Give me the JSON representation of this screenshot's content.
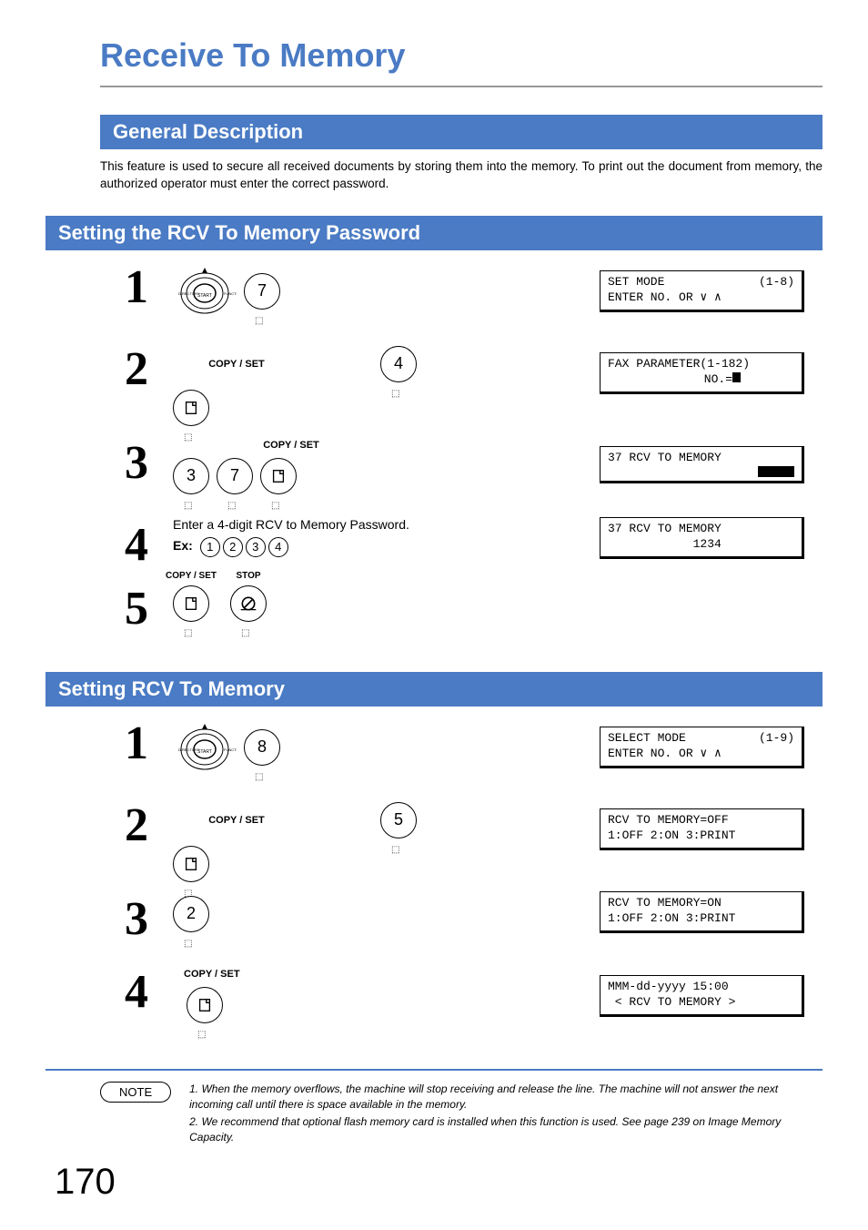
{
  "title": "Receive To Memory",
  "sections": {
    "general": {
      "heading": "General Description",
      "text": "This feature is used to secure all received documents by storing them into the memory.  To print out the document from memory, the authorized operator must enter the correct password."
    },
    "password": {
      "heading": "Setting the RCV To Memory Password",
      "steps": {
        "s1": {
          "num": "1",
          "key": "7",
          "lcd_l1a": "SET MODE",
          "lcd_l1b": "(1-8)",
          "lcd_l2": "ENTER NO. OR ∨ ∧"
        },
        "s2": {
          "num": "2",
          "label": "COPY / SET",
          "key": "4",
          "lcd_l1": "FAX PARAMETER(1-182)",
          "lcd_l2": "      NO.="
        },
        "s3": {
          "num": "3",
          "label": "COPY / SET",
          "key1": "3",
          "key2": "7",
          "lcd_l1": "37 RCV TO MEMORY"
        },
        "s4": {
          "num": "4",
          "text": "Enter a 4-digit RCV to Memory Password.",
          "ex_label": "Ex:",
          "ex_keys": [
            "1",
            "2",
            "3",
            "4"
          ],
          "lcd_l1": "37 RCV TO MEMORY",
          "lcd_l2": "            1234"
        },
        "s5": {
          "num": "5",
          "label1": "COPY / SET",
          "label2": "STOP"
        }
      }
    },
    "setting": {
      "heading": "Setting RCV To Memory",
      "steps": {
        "s1": {
          "num": "1",
          "key": "8",
          "lcd_l1a": "SELECT MODE",
          "lcd_l1b": "(1-9)",
          "lcd_l2": "ENTER NO. OR ∨ ∧"
        },
        "s2": {
          "num": "2",
          "label": "COPY / SET",
          "key": "5",
          "lcd_l1": "RCV TO MEMORY=OFF",
          "lcd_l2": "1:OFF 2:ON 3:PRINT"
        },
        "s3": {
          "num": "3",
          "key": "2",
          "lcd_l1": "RCV TO MEMORY=ON",
          "lcd_l2": "1:OFF 2:ON 3:PRINT"
        },
        "s4": {
          "num": "4",
          "label": "COPY / SET",
          "lcd_l1": "MMM-dd-yyyy 15:00",
          "lcd_l2": " < RCV TO MEMORY >"
        }
      }
    }
  },
  "note": {
    "label": "NOTE",
    "n1": "1. When the memory overflows, the machine will stop receiving and release the line.  The machine will not answer the next incoming call until there is space available in the memory.",
    "n2": "2. We recommend that optional flash memory card is installed when this function is used. See page 239 on Image Memory Capacity."
  },
  "page_number": "170",
  "icons": {
    "function": "function-dial",
    "copy_set": "copy-set-key",
    "stop": "stop-key",
    "finger": "press-indicator"
  }
}
